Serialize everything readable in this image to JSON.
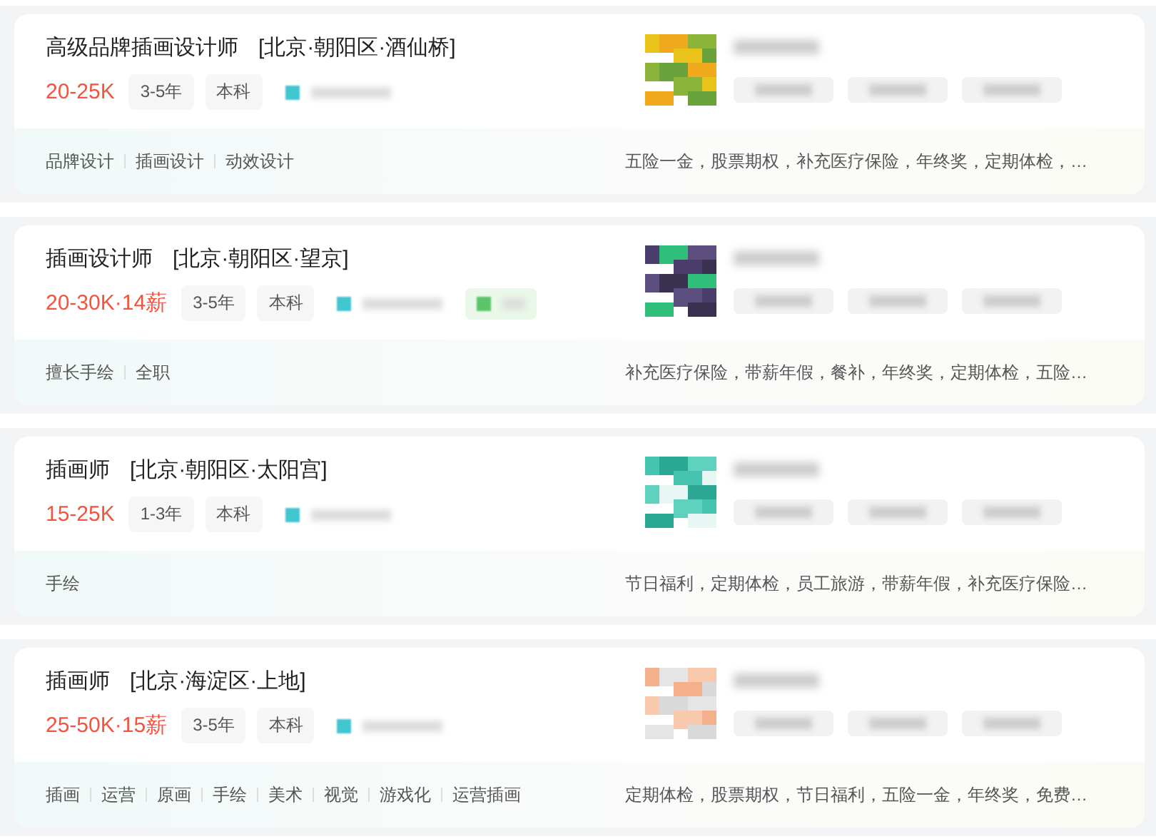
{
  "jobs": [
    {
      "title": "高级品牌插画设计师",
      "location": "[北京·朝阳区·酒仙桥]",
      "salary": "20-25K",
      "tags": [
        "3-5年",
        "本科"
      ],
      "obscured_tags": [
        {
          "kind": "teal"
        }
      ],
      "logo": {
        "kind": "picture"
      },
      "skills": [
        "品牌设计",
        "插画设计",
        "动效设计"
      ],
      "benefits": "五险一金，股票期权，补充医疗保险，年终奖，定期体检，…"
    },
    {
      "title": "插画设计师",
      "location": "[北京·朝阳区·望京]",
      "salary": "20-30K·14薪",
      "tags": [
        "3-5年",
        "本科"
      ],
      "obscured_tags": [
        {
          "kind": "teal"
        },
        {
          "kind": "green"
        }
      ],
      "logo": {
        "kind": "picture"
      },
      "skills": [
        "擅长手绘",
        "全职"
      ],
      "benefits": "补充医疗保险，带薪年假，餐补，年终奖，定期体检，五险…"
    },
    {
      "title": "插画师",
      "location": "[北京·朝阳区·太阳宫]",
      "salary": "15-25K",
      "tags": [
        "1-3年",
        "本科"
      ],
      "obscured_tags": [
        {
          "kind": "teal"
        }
      ],
      "logo": {
        "kind": "picture"
      },
      "skills": [
        "手绘"
      ],
      "benefits": "节日福利，定期体检，员工旅游，带薪年假，补充医疗保险…"
    },
    {
      "title": "插画师",
      "location": "[北京·海淀区·上地]",
      "salary": "25-50K·15薪",
      "tags": [
        "3-5年",
        "本科"
      ],
      "obscured_tags": [
        {
          "kind": "teal"
        }
      ],
      "logo": {
        "kind": "picture"
      },
      "skills": [
        "插画",
        "运营",
        "原画",
        "手绘",
        "美术",
        "视觉",
        "游戏化",
        "运营插画"
      ],
      "benefits": "定期体检，股票期权，节日福利，五险一金，年终奖，免费…"
    }
  ]
}
